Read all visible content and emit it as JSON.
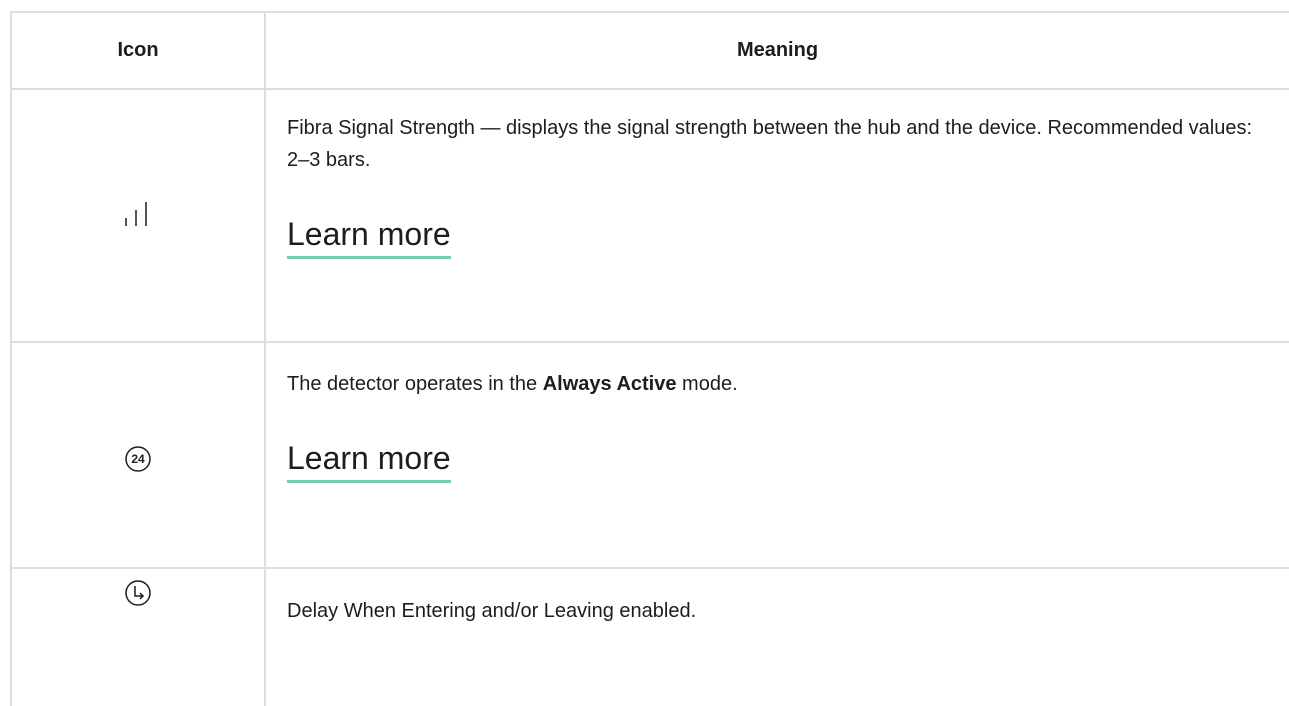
{
  "header": {
    "icon_label": "Icon",
    "meaning_label": "Meaning"
  },
  "rows": [
    {
      "icon": "signal-strength-icon",
      "text": "Fibra Signal Strength — displays the signal strength between the hub and the device. Recommended values: 2–3 bars.",
      "link": "Learn more"
    },
    {
      "icon": "always-active-24-icon",
      "icon_text": "24",
      "text_before": "The detector operates in the ",
      "text_bold": "Always Active",
      "text_after": " mode.",
      "link": "Learn more"
    },
    {
      "icon": "delay-clock-icon",
      "text": "Delay When Entering and/or Leaving enabled."
    }
  ],
  "colors": {
    "border": "#dedede",
    "link_underline": "#5dd9a8",
    "text": "#1d1d1d"
  }
}
